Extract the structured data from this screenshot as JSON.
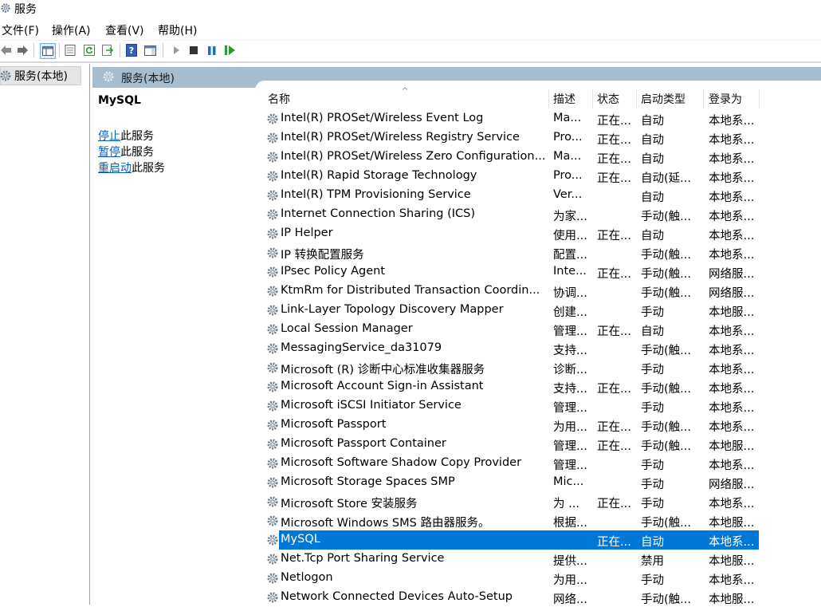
{
  "window": {
    "title": "服务"
  },
  "menu": [
    "文件(F)",
    "操作(A)",
    "查看(V)",
    "帮助(H)"
  ],
  "tree": {
    "root": "服务(本地)"
  },
  "panel_header": "服务(本地)",
  "detail": {
    "service_name": "MySQL",
    "actions": [
      {
        "link": "停止",
        "rest": "此服务"
      },
      {
        "link": "暂停",
        "rest": "此服务"
      },
      {
        "link": "重启动",
        "rest": "此服务"
      }
    ]
  },
  "columns": {
    "name": "名称",
    "desc": "描述",
    "status": "状态",
    "startup": "启动类型",
    "logon": "登录为"
  },
  "services": [
    {
      "name": "Intel(R) PROSet/Wireless Event Log",
      "desc": "Ma...",
      "status": "正在...",
      "startup": "自动",
      "logon": "本地系..."
    },
    {
      "name": "Intel(R) PROSet/Wireless Registry Service",
      "desc": "Pro...",
      "status": "正在...",
      "startup": "自动",
      "logon": "本地系..."
    },
    {
      "name": "Intel(R) PROSet/Wireless Zero Configuration...",
      "desc": "Ma...",
      "status": "正在...",
      "startup": "自动",
      "logon": "本地系..."
    },
    {
      "name": "Intel(R) Rapid Storage Technology",
      "desc": "Pro...",
      "status": "正在...",
      "startup": "自动(延...",
      "logon": "本地系..."
    },
    {
      "name": "Intel(R) TPM Provisioning Service",
      "desc": "Ver...",
      "status": "",
      "startup": "自动",
      "logon": "本地系..."
    },
    {
      "name": "Internet Connection Sharing (ICS)",
      "desc": "为家...",
      "status": "",
      "startup": "手动(触...",
      "logon": "本地系..."
    },
    {
      "name": "IP Helper",
      "desc": "使用...",
      "status": "正在...",
      "startup": "自动",
      "logon": "本地系..."
    },
    {
      "name": "IP 转换配置服务",
      "desc": "配置...",
      "status": "",
      "startup": "手动(触...",
      "logon": "本地系..."
    },
    {
      "name": "IPsec Policy Agent",
      "desc": "Inte...",
      "status": "正在...",
      "startup": "手动(触...",
      "logon": "网络服..."
    },
    {
      "name": "KtmRm for Distributed Transaction Coordin...",
      "desc": "协调...",
      "status": "",
      "startup": "手动(触...",
      "logon": "网络服..."
    },
    {
      "name": "Link-Layer Topology Discovery Mapper",
      "desc": "创建...",
      "status": "",
      "startup": "手动",
      "logon": "本地服..."
    },
    {
      "name": "Local Session Manager",
      "desc": "管理...",
      "status": "正在...",
      "startup": "自动",
      "logon": "本地系..."
    },
    {
      "name": "MessagingService_da31079",
      "desc": "支持...",
      "status": "",
      "startup": "手动(触...",
      "logon": "本地系..."
    },
    {
      "name": "Microsoft (R) 诊断中心标准收集器服务",
      "desc": "诊断...",
      "status": "",
      "startup": "手动",
      "logon": "本地系..."
    },
    {
      "name": "Microsoft Account Sign-in Assistant",
      "desc": "支持...",
      "status": "正在...",
      "startup": "手动(触...",
      "logon": "本地系..."
    },
    {
      "name": "Microsoft iSCSI Initiator Service",
      "desc": "管理...",
      "status": "",
      "startup": "手动",
      "logon": "本地系..."
    },
    {
      "name": "Microsoft Passport",
      "desc": "为用...",
      "status": "正在...",
      "startup": "手动(触...",
      "logon": "本地系..."
    },
    {
      "name": "Microsoft Passport Container",
      "desc": "管理...",
      "status": "正在...",
      "startup": "手动(触...",
      "logon": "本地服..."
    },
    {
      "name": "Microsoft Software Shadow Copy Provider",
      "desc": "管理...",
      "status": "",
      "startup": "手动",
      "logon": "本地系..."
    },
    {
      "name": "Microsoft Storage Spaces SMP",
      "desc": "Mic...",
      "status": "",
      "startup": "手动",
      "logon": "网络服..."
    },
    {
      "name": "Microsoft Store 安装服务",
      "desc": "为 ...",
      "status": "正在...",
      "startup": "手动",
      "logon": "本地系..."
    },
    {
      "name": "Microsoft Windows SMS 路由器服务。",
      "desc": "根据...",
      "status": "",
      "startup": "手动(触...",
      "logon": "本地服..."
    },
    {
      "name": "MySQL",
      "desc": "",
      "status": "正在...",
      "startup": "自动",
      "logon": "本地系...",
      "selected": true
    },
    {
      "name": "Net.Tcp Port Sharing Service",
      "desc": "提供...",
      "status": "",
      "startup": "禁用",
      "logon": "本地服..."
    },
    {
      "name": "Netlogon",
      "desc": "为用...",
      "status": "",
      "startup": "手动",
      "logon": "本地系..."
    },
    {
      "name": "Network Connected Devices Auto-Setup",
      "desc": "网络...",
      "status": "",
      "startup": "手动(触...",
      "logon": "本地服..."
    }
  ],
  "colors": {
    "selection": "#0078d7",
    "header_bg": "#a6bccf",
    "link": "#0b5fb0"
  }
}
